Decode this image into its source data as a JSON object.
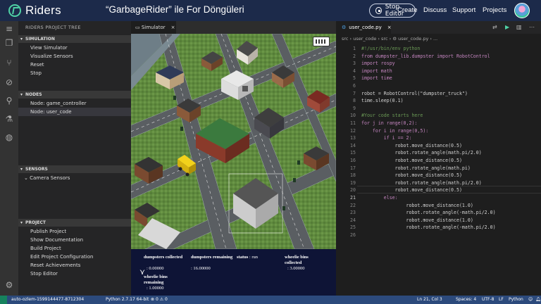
{
  "header": {
    "brand": "Riders",
    "project_title": "“GarbageRider” ile For Döngüleri",
    "stop_label": "Stop Editor",
    "links": [
      "Create",
      "Discuss",
      "Support",
      "Projects"
    ]
  },
  "sidebar": {
    "title": "RIDERS PROJECT TREE",
    "sections": [
      {
        "name": "SIMULATION",
        "items": [
          "View Simulator",
          "Visualize Sensors",
          "Reset",
          "Stop"
        ]
      },
      {
        "name": "NODES",
        "items": [
          "Node: game_controller",
          "Node: user_code"
        ]
      },
      {
        "name": "SENSORS",
        "items": [
          "Camera Sensors"
        ]
      },
      {
        "name": "PROJECT",
        "items": [
          "Publish Project",
          "Show Documentation",
          "Build Project",
          "Edit Project Configuration",
          "Reset Achievements",
          "Stop Editor"
        ]
      }
    ],
    "selected": "Node: user_code"
  },
  "simulator": {
    "tab_label": "Simulator",
    "stats": {
      "dumpsters_collected_label": "dumpsters collected",
      "dumpsters_collected_value": ": 0.00000",
      "dumpsters_remaining_label": "dumpsters remaining",
      "dumpsters_remaining_value": ": 16.00000",
      "status_label": "status",
      "status_value": ": run",
      "wheelie_collected_label": "wheelie bins collected",
      "wheelie_collected_value": ": 3.00000",
      "wheelie_remaining_label": "wheelie bins remaining",
      "wheelie_remaining_value": ": 1.00000"
    }
  },
  "editor": {
    "tab_label": "user_code.py",
    "breadcrumb": "src › user_code › src › ⚙ user_code.py › ...",
    "active_line": 21,
    "lines": [
      {
        "n": "1",
        "t": "#!/usr/bin/env python"
      },
      {
        "n": "2",
        "t": "from dumpster_lib.dumpster import RobotControl"
      },
      {
        "n": "3",
        "t": "import rospy"
      },
      {
        "n": "4",
        "t": "import math"
      },
      {
        "n": "5",
        "t": "import time"
      },
      {
        "n": "6",
        "t": ""
      },
      {
        "n": "7",
        "t": "robot = RobotControl(\"dumpster_truck\")"
      },
      {
        "n": "8",
        "t": "time.sleep(0.1)"
      },
      {
        "n": "9",
        "t": ""
      },
      {
        "n": "10",
        "t": "#Your code starts here"
      },
      {
        "n": "11",
        "t": "for j in range(0,2):"
      },
      {
        "n": "12",
        "t": "    for i in range(0,5):"
      },
      {
        "n": "13",
        "t": "        if i == 2:"
      },
      {
        "n": "14",
        "t": "            robot.move_distance(0.5)"
      },
      {
        "n": "15",
        "t": "            robot.rotate_angle(math.pi/2.0)"
      },
      {
        "n": "16",
        "t": "            robot.move_distance(0.5)"
      },
      {
        "n": "17",
        "t": "            robot.rotate_angle(math.pi)"
      },
      {
        "n": "18",
        "t": "            robot.move_distance(0.5)"
      },
      {
        "n": "19",
        "t": "            robot.rotate_angle(math.pi/2.0)"
      },
      {
        "n": "20",
        "t": "            robot.move_distance(0.5)"
      },
      {
        "n": "21",
        "t": "        else:"
      },
      {
        "n": "22",
        "t": "                robot.move_distance(1.0)"
      },
      {
        "n": "23",
        "t": "                robot.rotate_angle(-math.pi/2.0)"
      },
      {
        "n": "24",
        "t": "                robot.move_distance(1.0)"
      },
      {
        "n": "25",
        "t": "                robot.rotate_angle(-math.pi/2.0)"
      },
      {
        "n": "26",
        "t": ""
      }
    ]
  },
  "statusbar": {
    "host": "auto-ozlem-1599144477-8712304",
    "python": "Python 2.7.17 64-bit",
    "errors": "0",
    "warnings": "0",
    "position": "Ln 21, Col 3",
    "spaces": "Spaces: 4",
    "encoding": "UTF-8",
    "eol": "LF",
    "language": "Python"
  },
  "colors": {
    "keyword": "#c586c0",
    "comment": "#6a9955",
    "string": "#ce9178",
    "number": "#b5cea8",
    "function": "#dcdcaa",
    "accent": "#4fd1a5",
    "topbar": "#1c2a4a"
  }
}
